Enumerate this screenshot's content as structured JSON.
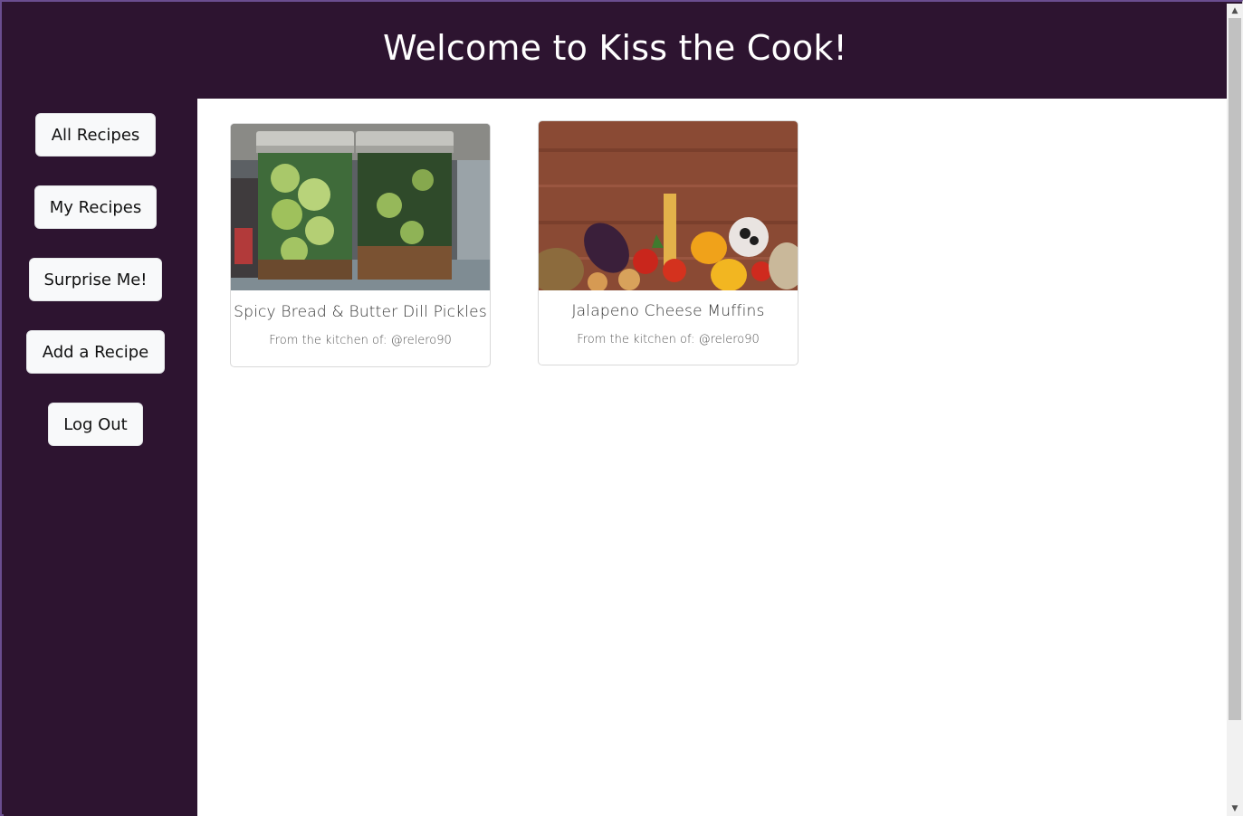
{
  "header": {
    "title": "Welcome to Kiss the Cook!"
  },
  "sidebar": {
    "items": [
      {
        "label": "All Recipes"
      },
      {
        "label": "My Recipes"
      },
      {
        "label": "Surprise Me!"
      },
      {
        "label": "Add a Recipe"
      },
      {
        "label": "Log Out"
      }
    ]
  },
  "recipes": [
    {
      "title": "Spicy Bread & Butter Dill Pickles",
      "author": "From the kitchen of: @relero90"
    },
    {
      "title": "Jalapeno Cheese Muffins",
      "author": "From the kitchen of: @relero90"
    }
  ],
  "colors": {
    "brand": "#2d1430",
    "button_bg": "#f8f9fa",
    "content_bg": "#ffffff"
  },
  "scrollbar": {
    "up_icon": "▲",
    "down_icon": "▼"
  }
}
